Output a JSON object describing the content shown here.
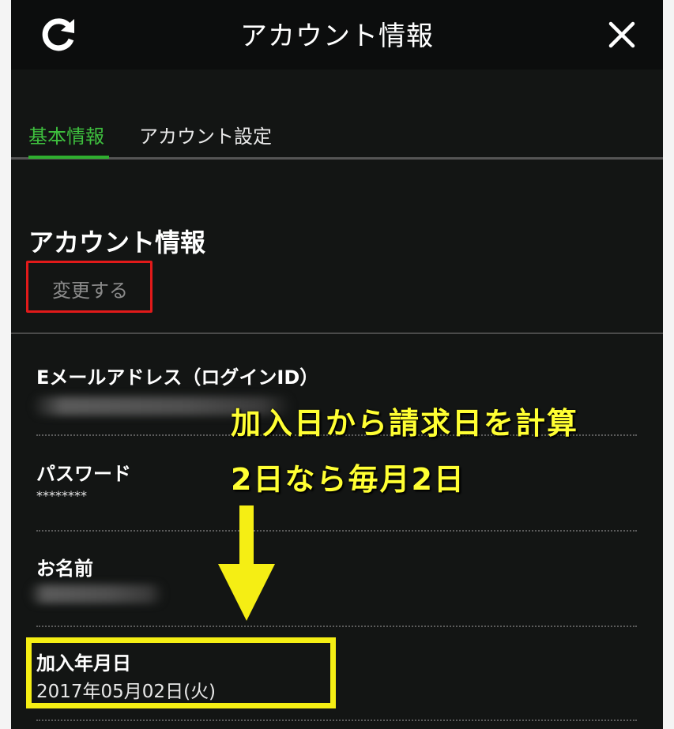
{
  "header": {
    "title": "アカウント情報"
  },
  "tabs": [
    {
      "label": "基本情報"
    },
    {
      "label": "アカウント設定"
    }
  ],
  "section": {
    "title": "アカウント情報",
    "change_label": "変更する"
  },
  "fields": {
    "email_label": "Eメールアドレス（ログインID）",
    "password_label": "パスワード",
    "password_value": "********",
    "name_label": "お名前",
    "join_label": "加入年月日",
    "join_value": "2017年05月02日(火)"
  },
  "annotation": {
    "line1": "加入日から請求日を計算",
    "line2": "2日なら毎月2日"
  },
  "colors": {
    "accent_green": "#2fae2f",
    "highlight_red": "#e21a1a",
    "annotation_yellow": "#f5ee14"
  }
}
